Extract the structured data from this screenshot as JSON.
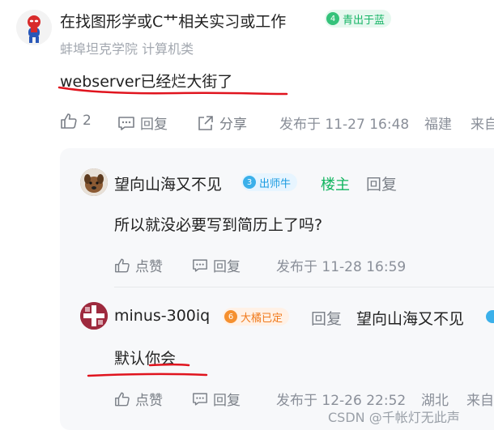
{
  "post": {
    "author": "在找图形学或C艹相关实习或工作",
    "level": "4",
    "badge": "青出于蓝",
    "school": "蚌埠坦克学院 计算机类",
    "content": "webserver已经烂大街了",
    "like_count": "2",
    "reply_label": "回复",
    "share_label": "分享",
    "time": "发布于 11-27 16:48",
    "location": "福建",
    "extra": "来自"
  },
  "replies": [
    {
      "author": "望向山海又不见",
      "level": "3",
      "badge": "出师牛",
      "owner_tag": "楼主",
      "reply_label": "回复",
      "content": "所以就没必要写到简历上了吗?",
      "like_label": "点赞",
      "reply_action": "回复",
      "time": "发布于 11-28 16:59"
    },
    {
      "author": "minus-300iq",
      "level": "6",
      "badge": "大橘已定",
      "reply_label": "回复",
      "reply_to": "望向山海又不见",
      "content": "默认你会",
      "like_label": "点赞",
      "reply_action": "回复",
      "time": "发布于 12-26 22:52",
      "location": "湖北",
      "extra": "来自"
    }
  ],
  "watermark": "CSDN @千帐灯无此声",
  "colors": {
    "green_badge_bg": "#e6f8ef",
    "green_badge_text": "#16b466",
    "blue_badge_bg": "#e7f5ff",
    "blue_badge_text": "#1a9be0",
    "orange_badge_bg": "#fff1e6",
    "orange_badge_text": "#f07a1c",
    "owner_green": "#12b560",
    "underline_red": "#e0141e"
  }
}
